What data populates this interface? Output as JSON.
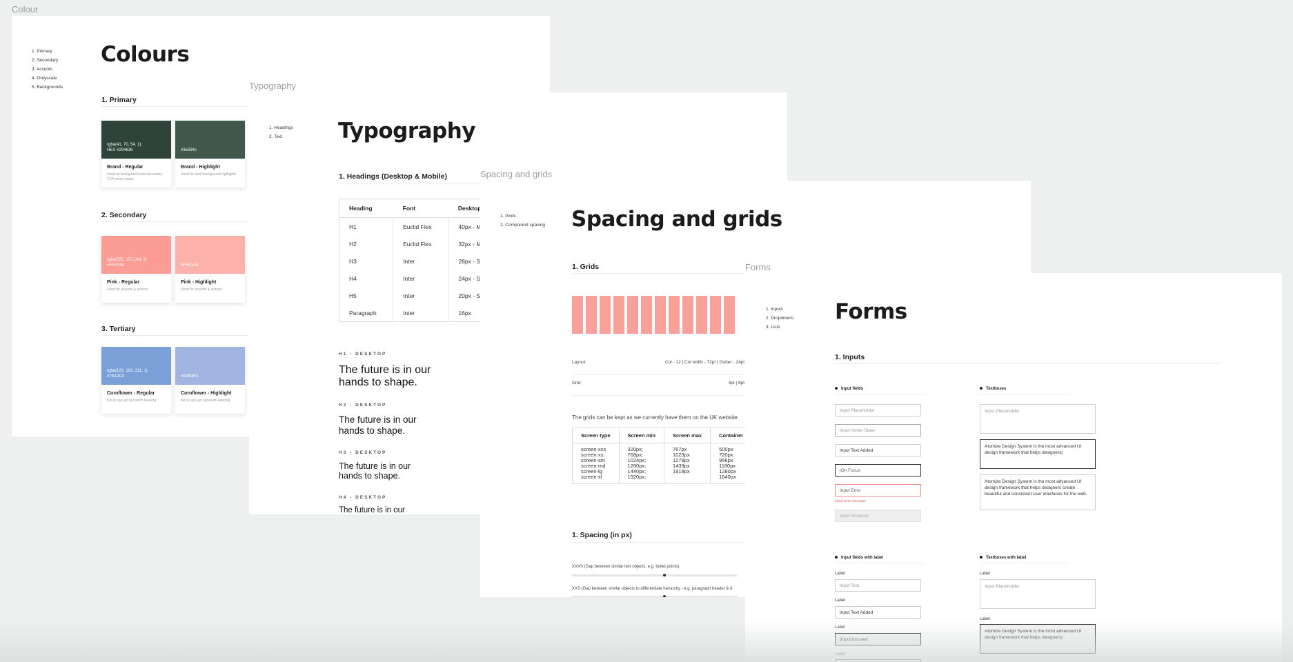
{
  "colour": {
    "frame_label": "Colour",
    "nav": [
      "1. Primary",
      "2. Secondary",
      "3. Accents",
      "4. Greyscale",
      "5. Backgrounds"
    ],
    "title": "Colours",
    "sections": [
      "1. Primary",
      "2. Secondary",
      "3. Tertiary"
    ],
    "cards": [
      {
        "value": "rgba(41, 70, 54, 1);\nHEX #294638",
        "name": "Brand - Regular",
        "desc": "Used on background and secondary CTA hover colour.",
        "color": "#2e4339"
      },
      {
        "value": "#3e594c",
        "name": "Brand - Highlight",
        "desc": "Used for dark background highlights",
        "color": "#3f584b"
      },
      {
        "value": "rgba(255, 157,148, 1)\n#FF9D94",
        "name": "Pink - Regular",
        "desc": "Used for accents & actions.",
        "color": "#fb9c95"
      },
      {
        "value": "#FFB1A9",
        "name": "Pink - Highlight",
        "desc": "Used for accents & actions.",
        "color": "#fcb1ab"
      },
      {
        "value": "rgba(120, 162, 211, 1)\n#78A2D3",
        "name": "Cornflower - Regular",
        "desc": "Not in use yet but worth keeping",
        "color": "#7ba0d8"
      },
      {
        "value": "#A0B3E3",
        "name": "Cornflower - Highlight",
        "desc": "Not in use yet but worth keeping",
        "color": "#a2b4e2"
      }
    ]
  },
  "typography": {
    "frame_label": "Typography",
    "nav": [
      "1. Headings",
      "2. Text"
    ],
    "title": "Typography",
    "section": "1. Headings (Desktop & Mobile)",
    "table": {
      "headers": [
        "Heading",
        "Font",
        "Desktop"
      ],
      "rows": [
        [
          "H1",
          "Euclid Flex",
          "40px - M"
        ],
        [
          "H2",
          "Euclid Flex",
          "32px - M"
        ],
        [
          "H3",
          "Inter",
          "28px - S"
        ],
        [
          "H4",
          "Inter",
          "24px - S"
        ],
        [
          "H5",
          "Inter",
          "20px - S"
        ],
        [
          "Paragraph",
          "Inter",
          "16px"
        ]
      ]
    },
    "samples": [
      {
        "eyebrow": "H1 - DESKTOP",
        "text": "The future is in our hands to shape."
      },
      {
        "eyebrow": "H2 - DESKTOP",
        "text": "The future is in our hands to shape."
      },
      {
        "eyebrow": "H3 - DESKTOP",
        "text": "The future is in our hands to shape."
      },
      {
        "eyebrow": "H4 - DESKTOP",
        "text": "The future is in our"
      }
    ]
  },
  "spacing": {
    "frame_label": "Spacing and grids",
    "nav": [
      "1. Grids",
      "2. Component spacing"
    ],
    "title": "Spacing and grids",
    "section_grids": "1. Grids",
    "grid_columns": 12,
    "layout_label": "Layout:",
    "layout_value": "Col - 12  |  Col width - 72pt  |  Gutter - 24pt",
    "grid_label": "Grid:",
    "grid_value": "4pt  |  8pt",
    "note": "The grids can be kept as we currently have them on the UK website.",
    "screens": {
      "headers": [
        "Screen type",
        "Screen min",
        "Screen max",
        "Container"
      ],
      "col_type": "screen-xxs\nscreen-xs\nscreen-sm\nscreen-md\nscreen-lg\nscreen-xl",
      "col_min": "320px;\n768px;\n1024px;\n1280px;\n1440px;\n1920px;",
      "col_max": "767px\n1023px\n1279px\n1439px\n1919px",
      "col_container": "500px\n720px\n956px\n1180px\n1280px\n1640px"
    },
    "section_spacing": "1. Spacing (in px)",
    "spacing_rows": [
      "XXXS (Gap between similar text objects, e.g. bullet points)",
      "XXS (Gap between similar objects to differentiate hierarchy - e.g. paragraph header & d"
    ]
  },
  "forms": {
    "frame_label": "Forms",
    "nav": [
      "1. Inputs",
      "2. Dropdowns",
      "3. Lists"
    ],
    "title": "Forms",
    "section": "1. Inputs",
    "input_fields_label": "Input fields",
    "textboxes_label": "Textboxes",
    "inputs": {
      "placeholder": "Input Placeholder",
      "hover": "Input Hover State",
      "added": "Input Text Added",
      "focus": "|On Focus",
      "error": "Input Error",
      "error_message": "Input error message",
      "disabled": "Input Disabled"
    },
    "textboxes": {
      "placeholder": "Input Placeholder",
      "focused": "Atomize Design System is the most advanced UI design framework that helps designers|",
      "filled": "Atomize Design System is the most advanced UI design framework that helps designers create beautiful and consistent user interfaces for the web."
    },
    "labeled_fields_label": "Input fields with label",
    "labeled_textboxes_label": "Textboxes with label",
    "label": "Label",
    "labeled": {
      "text": "Input Text",
      "added": "Input Text Added",
      "focused": "|Input focused",
      "tb_placeholder": "Input Placeholder",
      "tb_focused": "Atomize Design System is the most advanced UI design framework that helps designers|"
    }
  }
}
